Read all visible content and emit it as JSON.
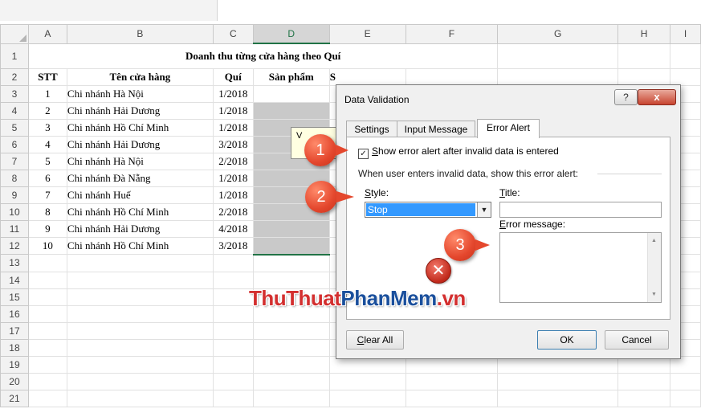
{
  "sheet": {
    "columns": [
      "A",
      "B",
      "C",
      "D",
      "E",
      "F",
      "G",
      "H",
      "I"
    ],
    "rows": [
      "1",
      "2",
      "3",
      "4",
      "5",
      "6",
      "7",
      "8",
      "9",
      "10",
      "11",
      "12",
      "13",
      "14",
      "15",
      "16",
      "17",
      "18",
      "19",
      "20",
      "21"
    ],
    "title": "Doanh thu từng cửa hàng theo Quí",
    "headers": {
      "stt": "STT",
      "store": "Tên cửa hàng",
      "quarter": "Quí",
      "product": "Sản phẩm",
      "partial": "S"
    },
    "data": [
      {
        "stt": "1",
        "store": "Chi nhánh Hà Nội",
        "quarter": "1/2018"
      },
      {
        "stt": "2",
        "store": "Chi nhánh Hải Dương",
        "quarter": "1/2018"
      },
      {
        "stt": "3",
        "store": "Chi nhánh Hồ Chí Minh",
        "quarter": "1/2018"
      },
      {
        "stt": "4",
        "store": "Chi nhánh Hải Dương",
        "quarter": "3/2018"
      },
      {
        "stt": "5",
        "store": "Chi nhánh Hà Nội",
        "quarter": "2/2018"
      },
      {
        "stt": "6",
        "store": "Chi nhánh Đà Nẵng",
        "quarter": "1/2018"
      },
      {
        "stt": "7",
        "store": "Chi nhánh Huế",
        "quarter": "1/2018"
      },
      {
        "stt": "8",
        "store": "Chi nhánh Hồ Chí Minh",
        "quarter": "2/2018"
      },
      {
        "stt": "9",
        "store": "Chi nhánh Hải Dương",
        "quarter": "4/2018"
      },
      {
        "stt": "10",
        "store": "Chi nhánh Hồ Chí Minh",
        "quarter": "3/2018"
      }
    ],
    "tooltip_partial": "V"
  },
  "dialog": {
    "title": "Data Validation",
    "help_label": "?",
    "close_label": "x",
    "tabs": [
      "Settings",
      "Input Message",
      "Error Alert"
    ],
    "show_alert": {
      "checked": true,
      "key": "S",
      "label": "how error alert after invalid data is entered",
      "check_glyph": "✓"
    },
    "group_label": "When user enters invalid data, show this error alert:",
    "style_label": {
      "key": "S",
      "rest": "tyle:"
    },
    "style_value": "Stop",
    "dropdown_glyph": "▼",
    "title_label": {
      "key": "T",
      "rest": "itle:"
    },
    "title_value": "",
    "message_label": {
      "key": "E",
      "rest": "rror message:"
    },
    "message_value": "",
    "scroll_up": "▲",
    "scroll_down": "▼",
    "icon_glyph": "✕",
    "clear_all": {
      "key": "C",
      "rest": "lear All"
    },
    "ok_label": "OK",
    "cancel_label": "Cancel"
  },
  "callouts": [
    "1",
    "2",
    "3"
  ],
  "watermark": {
    "part1": "ThuThuat",
    "part2": "PhanMem",
    "part3": ".vn"
  },
  "colors": {
    "accent_green": "#217346",
    "callout_red": "#e4472d",
    "selection_blue": "#3399ff",
    "cell_gray": "#c9c9c9"
  }
}
